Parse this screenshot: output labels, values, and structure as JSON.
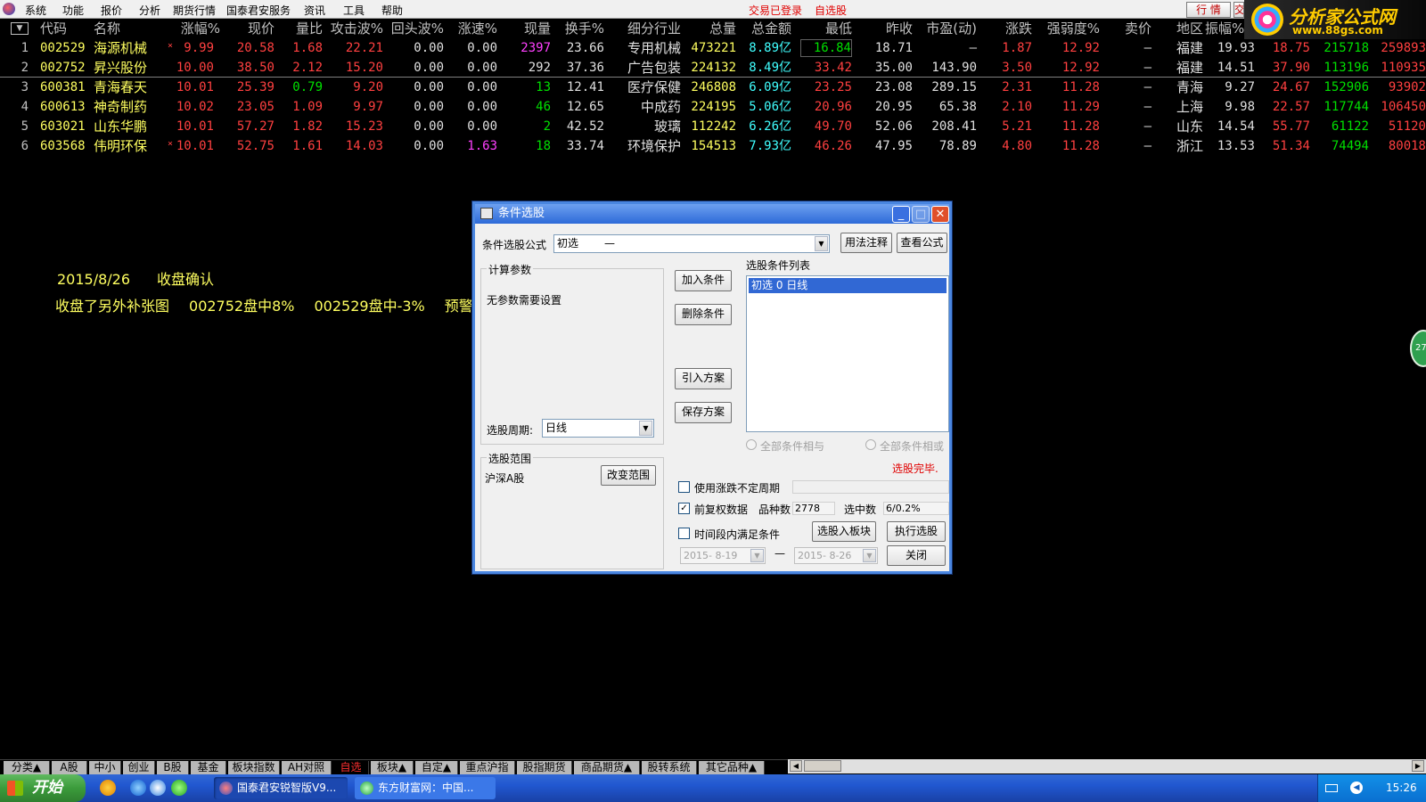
{
  "menubar": {
    "items": [
      "系统",
      "功能",
      "报价",
      "分析",
      "期货行情",
      "国泰君安服务",
      "资讯",
      "工具",
      "帮助"
    ],
    "status_login": "交易已登录",
    "status_watch": "自选股",
    "btn_hangqing": "行 情",
    "btn_jiaoyi": "交"
  },
  "logo": {
    "title": "分析家公式网",
    "url": "www.88gs.com"
  },
  "table": {
    "headers": [
      "代码",
      "名称",
      "涨幅%",
      "现价",
      "量比",
      "攻击波%",
      "回头波%",
      "涨速%",
      "现量",
      "换手%",
      "细分行业",
      "总量",
      "总金额",
      "最低",
      "昨收",
      "市盈(动)",
      "涨跌",
      "强弱度%",
      "卖价",
      "地区",
      "振幅%"
    ],
    "rows": [
      {
        "idx": "1",
        "code": "002529",
        "name": "海源机械",
        "star": "×",
        "chg": "9.99",
        "price": "20.58",
        "vr": "1.68",
        "atk": "22.21",
        "back": "0.00",
        "spd": "0.00",
        "vol": "2397",
        "turn": "23.66",
        "ind": "专用机械",
        "total": "473221",
        "amt": "8.89亿",
        "low": "16.84",
        "prev": "18.71",
        "pe": "—",
        "diff": "1.87",
        "str": "12.92",
        "ask": "—",
        "area": "福建",
        "amp": "19.93",
        "x1": "18.75",
        "x2": "215718",
        "x3": "259893"
      },
      {
        "idx": "2",
        "code": "002752",
        "name": "昇兴股份",
        "star": "",
        "chg": "10.00",
        "price": "38.50",
        "vr": "2.12",
        "atk": "15.20",
        "back": "0.00",
        "spd": "0.00",
        "vol": "292",
        "turn": "37.36",
        "ind": "广告包装",
        "total": "224132",
        "amt": "8.49亿",
        "low": "33.42",
        "prev": "35.00",
        "pe": "143.90",
        "diff": "3.50",
        "str": "12.92",
        "ask": "—",
        "area": "福建",
        "amp": "14.51",
        "x1": "37.90",
        "x2": "113196",
        "x3": "110935"
      },
      {
        "idx": "3",
        "code": "600381",
        "name": "青海春天",
        "star": "",
        "chg": "10.01",
        "price": "25.39",
        "vr": "0.79",
        "atk": "9.20",
        "back": "0.00",
        "spd": "0.00",
        "vol": "13",
        "turn": "12.41",
        "ind": "医疗保健",
        "total": "246808",
        "amt": "6.09亿",
        "low": "23.25",
        "prev": "23.08",
        "pe": "289.15",
        "diff": "2.31",
        "str": "11.28",
        "ask": "—",
        "area": "青海",
        "amp": "9.27",
        "x1": "24.67",
        "x2": "152906",
        "x3": "93902"
      },
      {
        "idx": "4",
        "code": "600613",
        "name": "神奇制药",
        "star": "",
        "chg": "10.02",
        "price": "23.05",
        "vr": "1.09",
        "atk": "9.97",
        "back": "0.00",
        "spd": "0.00",
        "vol": "46",
        "turn": "12.65",
        "ind": "中成药",
        "total": "224195",
        "amt": "5.06亿",
        "low": "20.96",
        "prev": "20.95",
        "pe": "65.38",
        "diff": "2.10",
        "str": "11.29",
        "ask": "—",
        "area": "上海",
        "amp": "9.98",
        "x1": "22.57",
        "x2": "117744",
        "x3": "106450"
      },
      {
        "idx": "5",
        "code": "603021",
        "name": "山东华鹏",
        "star": "",
        "chg": "10.01",
        "price": "57.27",
        "vr": "1.82",
        "atk": "15.23",
        "back": "0.00",
        "spd": "0.00",
        "vol": "2",
        "turn": "42.52",
        "ind": "玻璃",
        "total": "112242",
        "amt": "6.26亿",
        "low": "49.70",
        "prev": "52.06",
        "pe": "208.41",
        "diff": "5.21",
        "str": "11.28",
        "ask": "—",
        "area": "山东",
        "amp": "14.54",
        "x1": "55.77",
        "x2": "61122",
        "x3": "51120"
      },
      {
        "idx": "6",
        "code": "603568",
        "name": "伟明环保",
        "star": "×",
        "chg": "10.01",
        "price": "52.75",
        "vr": "1.61",
        "atk": "14.03",
        "back": "0.00",
        "spd": "1.63",
        "vol": "18",
        "turn": "33.74",
        "ind": "环境保护",
        "total": "154513",
        "amt": "7.93亿",
        "low": "46.26",
        "prev": "47.95",
        "pe": "78.89",
        "diff": "4.80",
        "str": "11.28",
        "ask": "—",
        "area": "浙江",
        "amp": "13.53",
        "x1": "51.34",
        "x2": "74494",
        "x3": "80018"
      }
    ]
  },
  "note": {
    "date": "2015/8/26",
    "confirm": "收盘确认",
    "line2": [
      "收盘了另外补张图",
      "002752盘中8%",
      "002529盘中-3%",
      "预警"
    ]
  },
  "dialog": {
    "title": "条件选股",
    "formula_label": "条件选股公式",
    "formula_value": "初选",
    "formula_dash": "—",
    "btn_usage": "用法注释",
    "btn_view": "查看公式",
    "calc_group": "计算参数",
    "no_params": "无参数需要设置",
    "period_label": "选股周期:",
    "period_value": "日线",
    "range_group": "选股范围",
    "range_value": "沪深A股",
    "btn_change_range": "改变范围",
    "btn_add": "加入条件",
    "btn_delete": "删除条件",
    "btn_import": "引入方案",
    "btn_save": "保存方案",
    "list_title": "选股条件列表",
    "list_items": [
      "初选  0  日线"
    ],
    "radio_and": "全部条件相与",
    "radio_or": "全部条件相或",
    "status_done": "选股完毕.",
    "chk_uncertain": "使用涨跌不定周期",
    "chk_adjust": "前复权数据",
    "count_label": "品种数",
    "count_value": "2778",
    "selected_label": "选中数",
    "selected_value": "6/0.2%",
    "chk_period": "时间段内满足条件",
    "btn_to_block": "选股入板块",
    "btn_execute": "执行选股",
    "date_from": "2015- 8-19",
    "date_to": "2015- 8-26",
    "date_dash": "—",
    "btn_close": "关闭"
  },
  "tabs": [
    "分类▲",
    "A股",
    "中小",
    "创业",
    "B股",
    "基金",
    "板块指数",
    "AH对照",
    "自选",
    "板块▲",
    "自定▲",
    "重点沪指",
    "股指期货",
    "商品期货▲",
    "股转系统",
    "其它品种▲"
  ],
  "taskbar": {
    "start": "开始",
    "task1": "国泰君安锐智版V9...",
    "task2": "东方财富网：中国...",
    "time": "15:26"
  },
  "side_badge": "27",
  "colors": {
    "up": "#ff4040",
    "down": "#00e000",
    "code": "#ffff60",
    "amount": "#40ffff",
    "xp_blue": "#2157d0"
  }
}
